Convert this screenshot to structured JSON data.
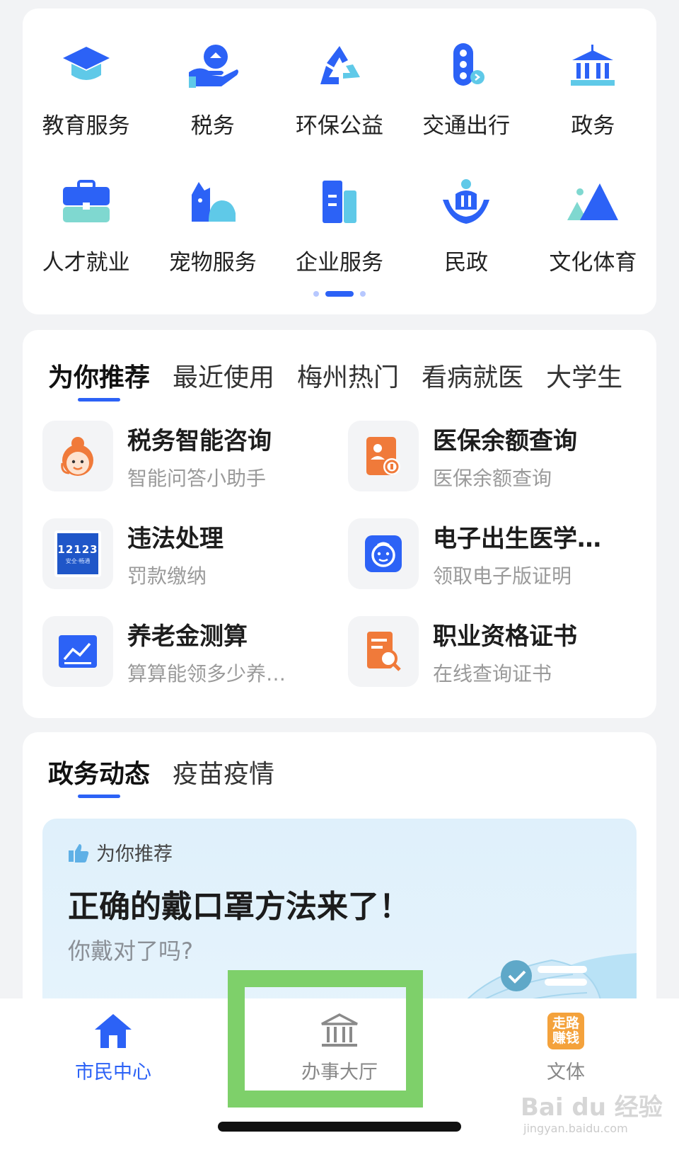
{
  "services": [
    {
      "label": "教育服务",
      "icon": "graduation-cap-icon"
    },
    {
      "label": "税务",
      "icon": "tax-hand-icon"
    },
    {
      "label": "环保公益",
      "icon": "recycle-icon"
    },
    {
      "label": "交通出行",
      "icon": "traffic-light-icon"
    },
    {
      "label": "政务",
      "icon": "government-building-icon"
    },
    {
      "label": "人才就业",
      "icon": "briefcase-icon"
    },
    {
      "label": "宠物服务",
      "icon": "pet-icon"
    },
    {
      "label": "企业服务",
      "icon": "office-building-icon"
    },
    {
      "label": "民政",
      "icon": "people-care-icon"
    },
    {
      "label": "文化体育",
      "icon": "mountain-icon"
    }
  ],
  "pager": {
    "pages": 3,
    "current": 2
  },
  "recommend_tabs": [
    "为你推荐",
    "最近使用",
    "梅州热门",
    "看病就医",
    "大学生"
  ],
  "recommend_items": [
    {
      "title": "税务智能咨询",
      "subtitle": "智能问答小助手",
      "icon": "assistant-avatar-icon"
    },
    {
      "title": "医保余额查询",
      "subtitle": "医保余额查询",
      "icon": "medical-insurance-icon"
    },
    {
      "title": "违法处理",
      "subtitle": "罚款缴纳",
      "icon": "app-12123-icon",
      "icon_text": "12123",
      "icon_subtext": "安全·畅通"
    },
    {
      "title": "电子出生医学…",
      "subtitle": "领取电子版证明",
      "icon": "baby-face-icon"
    },
    {
      "title": "养老金测算",
      "subtitle": "算算能领多少养…",
      "icon": "line-chart-icon"
    },
    {
      "title": "职业资格证书",
      "subtitle": "在线查询证书",
      "icon": "certificate-search-icon"
    }
  ],
  "news_tabs": [
    "政务动态",
    "疫苗疫情"
  ],
  "news_banner": {
    "tag": "为你推荐",
    "title": "正确的戴口罩方法来了！",
    "subtitle": "你戴对了吗?"
  },
  "bottom_nav": [
    {
      "label": "市民中心",
      "icon": "home-icon",
      "active": true
    },
    {
      "label": "办事大厅",
      "icon": "service-hall-icon",
      "active": false
    },
    {
      "label": "文体",
      "icon": "walk-earn-icon",
      "icon_text_1": "走路",
      "icon_text_2": "赚钱",
      "active": false
    }
  ],
  "watermark": {
    "text": "Bai du 经验",
    "sub": "jingyan.baidu.com"
  },
  "colors": {
    "accent": "#2c62f6",
    "highlight": "#7ed06a",
    "orange": "#f07a3a"
  }
}
